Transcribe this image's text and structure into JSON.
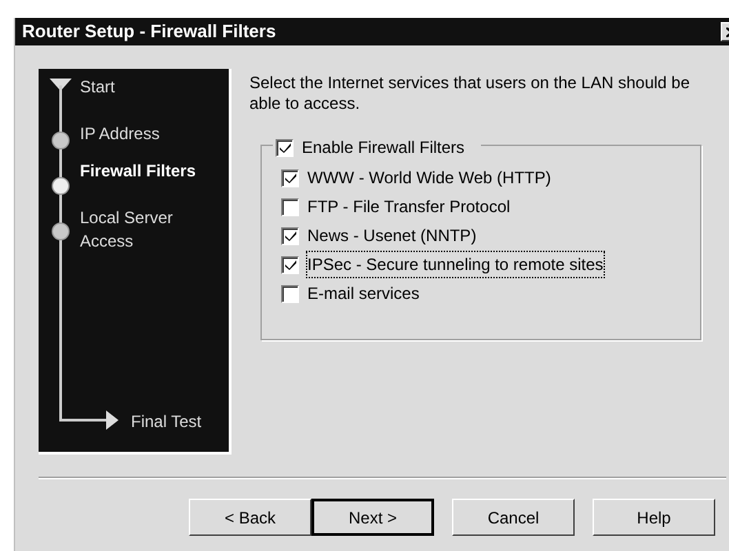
{
  "window": {
    "title": "Router Setup - Firewall Filters"
  },
  "steps": [
    {
      "label": "Start",
      "kind": "start",
      "selected": false
    },
    {
      "label": "IP Address",
      "kind": "step",
      "selected": false
    },
    {
      "label": "Firewall Filters",
      "kind": "step",
      "selected": true
    },
    {
      "label": "Local Server Access",
      "kind": "step",
      "selected": false
    },
    {
      "label": "Final Test",
      "kind": "end",
      "selected": false
    }
  ],
  "instruction": "Select the Internet services that users on the LAN should be able to access.",
  "group": {
    "label": "Enable Firewall Filters",
    "checked": true
  },
  "services": [
    {
      "label": "WWW -  World Wide Web (HTTP)",
      "checked": true,
      "focused": false
    },
    {
      "label": "FTP - File Transfer Protocol",
      "checked": false,
      "focused": false
    },
    {
      "label": "News - Usenet (NNTP)",
      "checked": true,
      "focused": false
    },
    {
      "label": "IPSec - Secure tunneling to remote sites",
      "checked": true,
      "focused": true
    },
    {
      "label": "E-mail services",
      "checked": false,
      "focused": false
    }
  ],
  "buttons": [
    {
      "label": "< Back",
      "kind": "normal"
    },
    {
      "label": "Next >",
      "kind": "default"
    },
    {
      "label": "Cancel",
      "kind": "normal"
    },
    {
      "label": "Help",
      "kind": "normal"
    }
  ]
}
